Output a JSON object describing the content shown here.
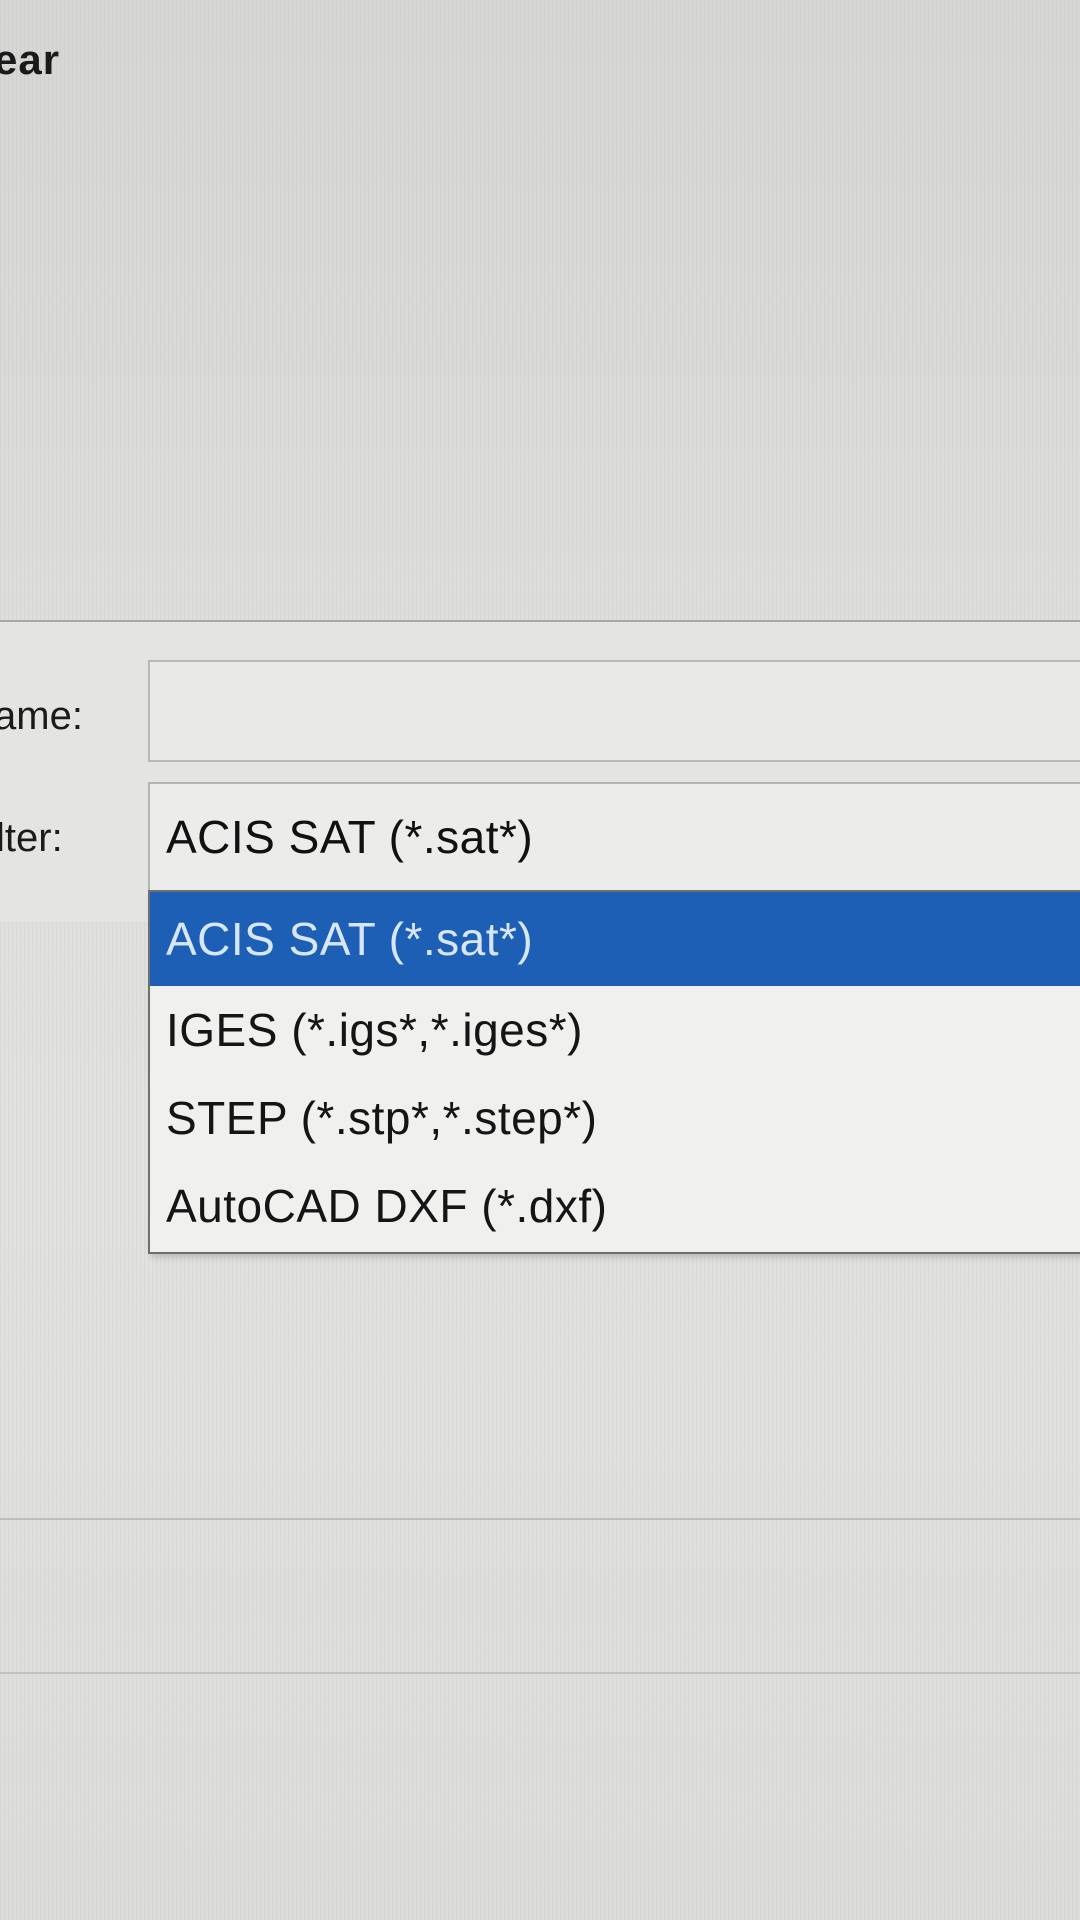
{
  "header": {
    "title_fragment": "ear"
  },
  "form": {
    "name_label": "ame:",
    "name_value": "",
    "filter_label": "lter:",
    "filter_selected": "ACIS SAT (*.sat*)"
  },
  "dropdown": {
    "options": [
      {
        "label": "ACIS SAT (*.sat*)",
        "selected": true
      },
      {
        "label": "IGES (*.igs*,*.iges*)",
        "selected": false
      },
      {
        "label": "STEP (*.stp*,*.step*)",
        "selected": false
      },
      {
        "label": "AutoCAD DXF (*.dxf)",
        "selected": false
      }
    ]
  },
  "colors": {
    "selection_highlight": "#1c5fb4",
    "background": "#dededc"
  }
}
